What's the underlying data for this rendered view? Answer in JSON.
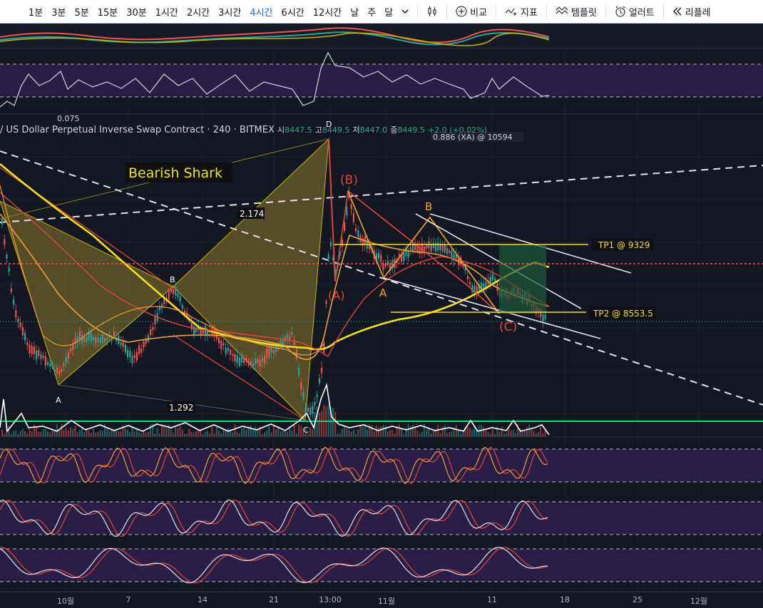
{
  "toolbar": {
    "timeframes": [
      "1분",
      "3분",
      "5분",
      "15분",
      "30분",
      "1시간",
      "2시간",
      "3시간",
      "4시간",
      "6시간",
      "12시간",
      "날",
      "주",
      "달"
    ],
    "active_timeframe": "4시간",
    "compare_label": "비교",
    "indicators_label": "지표",
    "templates_label": "템플릿",
    "alert_label": "얼러트",
    "replay_label": "리플레"
  },
  "legend": {
    "symbol": "/ US Dollar Perpetual Inverse Swap Contract · 240 · BITMEX",
    "open_label": "시",
    "open": "8447.5",
    "high_label": "고",
    "high": "8449.5",
    "low_label": "저",
    "low": "8447.0",
    "close_label": "종",
    "close": "8449.5",
    "change": "+2.0 (+0.02%)"
  },
  "rsi_label": "0.075",
  "chart_data": {
    "type": "candlestick",
    "title": "US Dollar Perpetual Inverse Swap Contract",
    "exchange": "BITMEX",
    "interval": "240",
    "x_ticks": [
      "10월",
      "7",
      "14",
      "21",
      "13:00",
      "11월",
      "11",
      "18",
      "25",
      "12월"
    ],
    "last": {
      "open": 8447.5,
      "high": 8449.5,
      "low": 8447.0,
      "close": 8449.5,
      "change": 2.0,
      "change_pct": 0.02
    },
    "pattern_name": "Bearish Shark",
    "pattern_points": [
      "A",
      "B",
      "C",
      "D"
    ],
    "ratios": [
      "2.174",
      "1.292"
    ],
    "xa_label": "0.886 (XA) @ 10594",
    "corrective_labels": [
      "(A)",
      "(B)",
      "(C)"
    ],
    "wave_labels": [
      "A",
      "B"
    ],
    "targets": [
      {
        "label": "TP1 @ 9329",
        "price": 9329
      },
      {
        "label": "TP2 @ 8553.5",
        "price": 8553.5
      }
    ],
    "colors": {
      "up": "#26a69a",
      "down": "#ef5350",
      "pattern": "#9c8a2e",
      "target": "#f5e11b",
      "ma": "#f5e11b"
    }
  }
}
